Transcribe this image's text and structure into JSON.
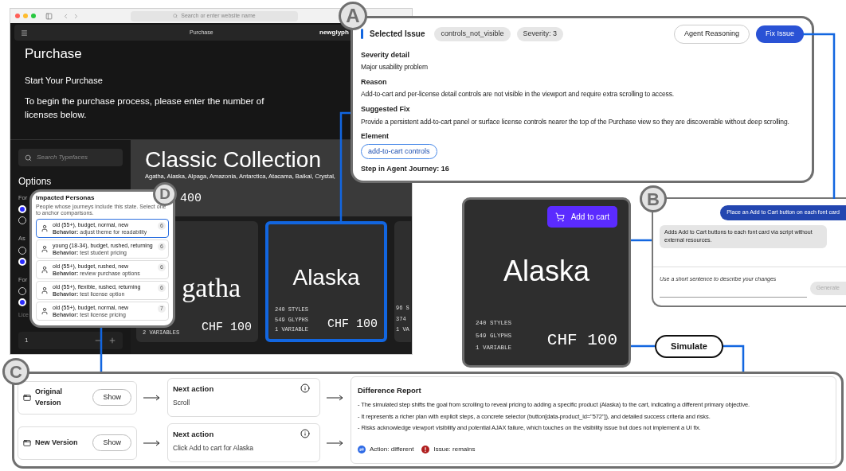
{
  "browser": {
    "address_placeholder": "Search or enter website name",
    "nav_title": "Purchase",
    "brand": "newglyph",
    "heading": "Purchase",
    "subheading": "Start Your Purchase",
    "intro": "To begin the purchase process, please enter the number of licenses below.",
    "sidebar": {
      "search_placeholder": "Search Typefaces",
      "title": "Options",
      "groups": [
        {
          "label": "For",
          "options": [
            {
              "selected": true
            },
            {
              "selected": false
            }
          ]
        },
        {
          "label": "As",
          "options": [
            {
              "selected": false
            },
            {
              "selected": true
            }
          ]
        },
        {
          "label": "For",
          "options": [
            {
              "selected": false
            },
            {
              "selected": true
            }
          ]
        }
      ],
      "quantity_label": "Lice",
      "quantity": "1"
    },
    "collection": {
      "title": "Classic Collection",
      "font_list": "Agatha, Alaska, Alpaga, Amazonia, Antarctica, Atacama, Baikal, Crystal,",
      "price": "400",
      "cards": [
        {
          "kind": "serif",
          "name": "gatha",
          "stats": [
            "2 VARIABLES"
          ],
          "price": "CHF 100",
          "highlighted": false
        },
        {
          "kind": "sans",
          "name": "Alaska",
          "stats": [
            "240 STYLES",
            "549 GLYPHS",
            "1 VARIABLE"
          ],
          "price": "CHF 100",
          "highlighted": true
        },
        {
          "kind": "partial",
          "stats": [
            "96 S",
            "374",
            "1 VA"
          ],
          "highlighted": false
        }
      ]
    }
  },
  "issue_panel": {
    "badge": "A",
    "title": "Selected Issue",
    "chips": [
      "controls_not_visible",
      "Severity: 3"
    ],
    "buttons": [
      {
        "label": "Agent Reasoning",
        "primary": false
      },
      {
        "label": "Fix Issue",
        "primary": true
      }
    ],
    "sections": [
      {
        "kind": "text",
        "heading": "Severity detail",
        "text": "Major usability problem"
      },
      {
        "kind": "text",
        "heading": "Reason",
        "text": "Add-to-cart and per-license detail controls are not visible in the viewport and require extra scrolling to access."
      },
      {
        "kind": "text",
        "heading": "Suggested Fix",
        "text": "Provide a persistent add-to-cart panel or surface license controls nearer the top of the Purchase view so they are discoverable without deep scrolling."
      },
      {
        "kind": "tag",
        "heading": "Element",
        "text": "add-to-cart controls"
      }
    ],
    "step": "Step in Agent Journey: 16"
  },
  "personas_panel": {
    "badge": "D",
    "title": "Impacted Personas",
    "subtitle": "People whose journeys include this state. Select one to anchor comparisons.",
    "personas": [
      {
        "title": "old (55+), budget, normal, new",
        "behavior": "**Behavior:** adjust theme for readability",
        "count": "6",
        "selected": true
      },
      {
        "title": "young (18-34), budget, rushed, returning",
        "behavior": "**Behavior:** test student pricing",
        "count": "6",
        "selected": false
      },
      {
        "title": "old (55+), budget, rushed, new",
        "behavior": "**Behavior:** review purchase options",
        "count": "6",
        "selected": false
      },
      {
        "title": "old (55+), flexible, rushed, returning",
        "behavior": "**Behavior:** test license option",
        "count": "6",
        "selected": false
      },
      {
        "title": "old (55+), budget, normal, new",
        "behavior": "**Behavior:** test license pricing",
        "count": "7",
        "selected": false
      }
    ]
  },
  "fix_chat": {
    "badge": "B",
    "messages": [
      {
        "kind": "request",
        "text": "Place an Add to Cart button on each font card"
      },
      {
        "kind": "reply",
        "text": "Adds Add to Cart buttons to each font card via script without external resources."
      }
    ],
    "input_placeholder": "Use a short sentence to describe your changes",
    "generate_button": {
      "label": "Generate",
      "disabled": true
    }
  },
  "preview_card": {
    "button": "Add to cart",
    "name": "Alaska",
    "stats": [
      "240 STYLES",
      "549 GLYPHS",
      "1 VARIABLE"
    ],
    "price": "CHF 100"
  },
  "simulate_button": "Simulate",
  "comparison": {
    "badge": "C",
    "rows": [
      {
        "title": "Original Version",
        "button": "Show",
        "next_heading": "Next action",
        "next_text": "Scroll"
      },
      {
        "title": "New Version",
        "button": "Show",
        "next_heading": "Next action",
        "next_text": "Click Add to cart for Alaska"
      }
    ],
    "report": {
      "title": "Difference Report",
      "bullets": [
        "- The simulated step shifts the goal from scrolling to reveal pricing to adding a specific product (Alaska) to the cart, indicating a different primary objective.",
        "- It represents a richer plan with explicit steps, a concrete selector (button[data-product_id=\"572\"]), and detailed success criteria and risks.",
        "- Risks acknowledge viewport visibility and potential AJAX failure, which touches on the visibility issue but does not implement a UI fix."
      ],
      "statuses": [
        {
          "kind": "changed",
          "label": "Action: different"
        },
        {
          "kind": "alert",
          "label": "Issue: remains"
        }
      ]
    }
  }
}
